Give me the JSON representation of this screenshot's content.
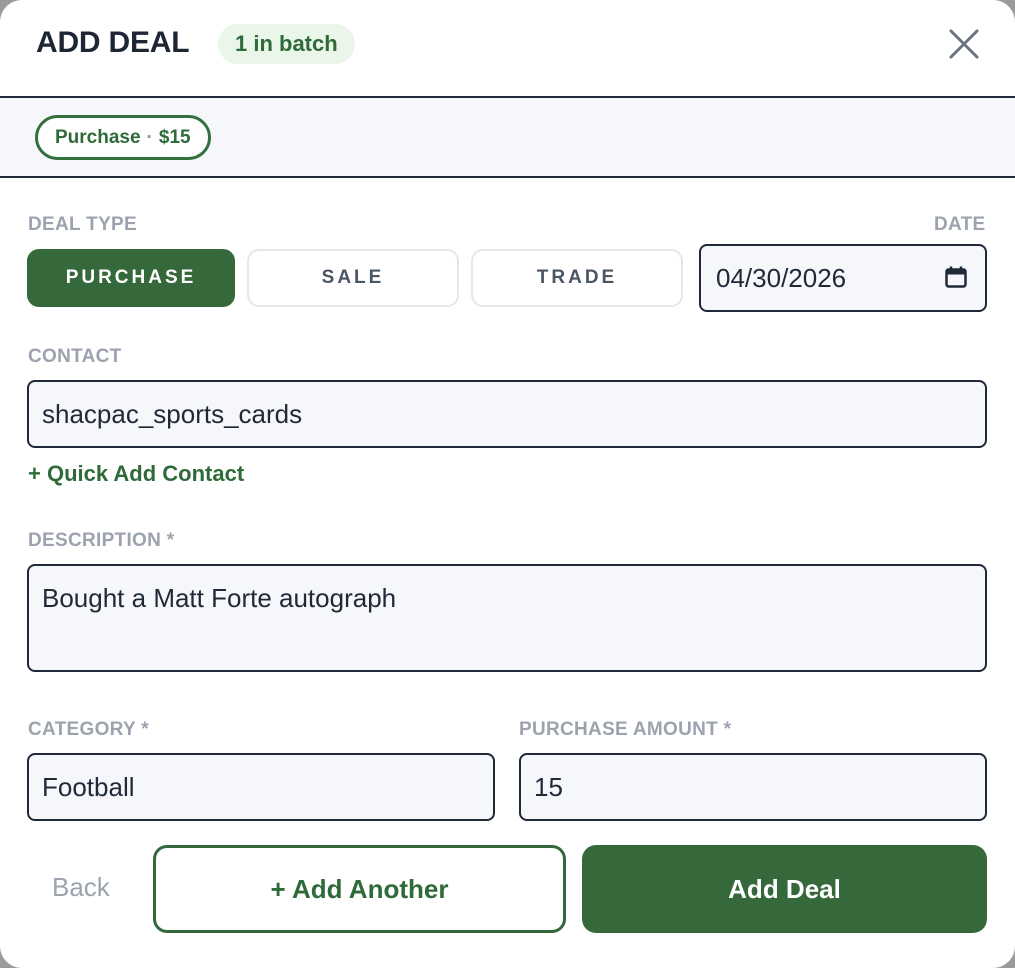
{
  "header": {
    "title": "ADD DEAL",
    "batch_badge": "1 in batch",
    "close_icon": "close-icon"
  },
  "batch": {
    "chips": [
      {
        "type": "Purchase",
        "separator": "·",
        "amount": "$15"
      }
    ]
  },
  "form": {
    "deal_type_label": "DEAL TYPE",
    "date_label": "DATE",
    "deal_types": [
      {
        "label": "PURCHASE",
        "selected": true
      },
      {
        "label": "SALE",
        "selected": false
      },
      {
        "label": "TRADE",
        "selected": false
      }
    ],
    "date_value": "04/30/2026",
    "calendar_icon": "calendar-icon",
    "contact_label": "CONTACT",
    "contact_value": "shacpac_sports_cards",
    "quick_add_contact": "+ Quick Add Contact",
    "description_label": "DESCRIPTION *",
    "description_value": "Bought a Matt Forte autograph",
    "category_label": "CATEGORY *",
    "category_value": "Football",
    "amount_label": "PURCHASE AMOUNT *",
    "amount_value": "15"
  },
  "footer": {
    "back": "Back",
    "add_another": "+ Add Another",
    "add_deal": "Add Deal"
  },
  "colors": {
    "primary_green": "#35683a",
    "badge_bg": "#ebf6ea",
    "label_gray": "#9ca3af",
    "field_bg": "#f5f7fa"
  }
}
